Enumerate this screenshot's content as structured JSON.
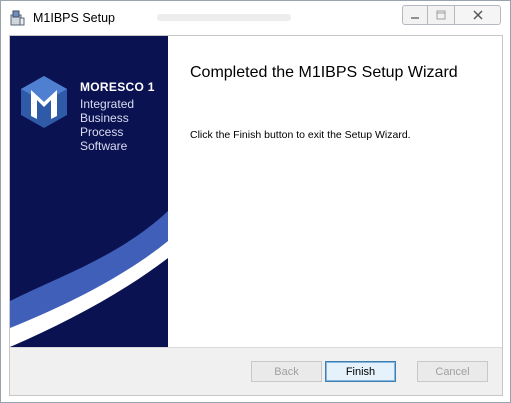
{
  "window": {
    "title": "M1IBPS Setup",
    "controls": {
      "minimize_icon": "minimize-icon",
      "maximize_icon": "maximize-icon",
      "close_icon": "close-icon"
    }
  },
  "banner": {
    "brand": "MORESCO 1",
    "tagline": [
      "Integrated",
      "Business",
      "Process",
      "Software"
    ],
    "colors": {
      "background": "#0b1252",
      "swoosh_light": "#3f5fb8",
      "swoosh_white": "#ffffff"
    }
  },
  "content": {
    "heading": "Completed the M1IBPS Setup Wizard",
    "body": "Click the Finish button to exit the Setup Wizard."
  },
  "buttons": {
    "back": "Back",
    "finish": "Finish",
    "cancel": "Cancel"
  }
}
